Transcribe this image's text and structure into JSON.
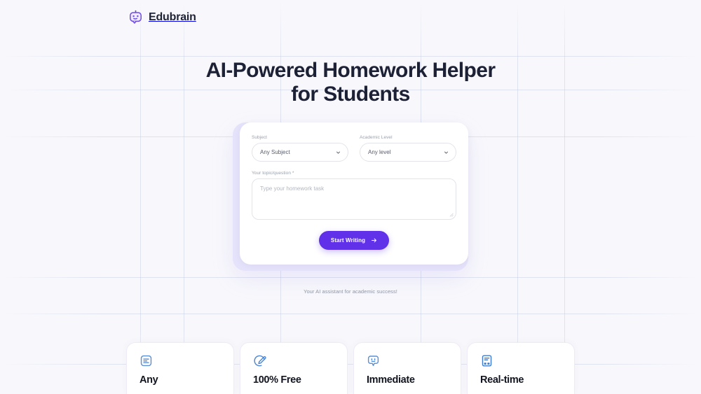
{
  "brand": {
    "name": "Edubrain",
    "logo_icon": "robot-head-icon",
    "logo_color": "#6d4ae0"
  },
  "hero": {
    "title": "AI-Powered Homework Helper for Students"
  },
  "form": {
    "subject": {
      "label": "Subject",
      "value": "Any Subject",
      "caret_icon": "chevron-down-icon"
    },
    "academic_level": {
      "label": "Academic Level",
      "value": "Any level",
      "caret_icon": "chevron-down-icon"
    },
    "topic": {
      "label": "Your topic/question *",
      "placeholder": "Type your homework task",
      "value": ""
    },
    "submit": {
      "label": "Start Writing",
      "arrow_icon": "arrow-right-icon",
      "color": "#6031e8"
    }
  },
  "tagline": "Your AI assistant for academic success!",
  "features": [
    {
      "title": "Any",
      "icon": "document-lines-icon",
      "icon_color": "#5b8fd6"
    },
    {
      "title": "100% Free",
      "icon": "pencil-circle-icon",
      "icon_color": "#4e86d4"
    },
    {
      "title": "Immediate",
      "icon": "chat-bubble-face-icon",
      "icon_color": "#5b8fd6"
    },
    {
      "title": "Real-time",
      "icon": "notebook-icon",
      "icon_color": "#3f7ccd"
    }
  ],
  "background": {
    "color": "#f8f8fc",
    "grid_color": "#bac4dc"
  }
}
